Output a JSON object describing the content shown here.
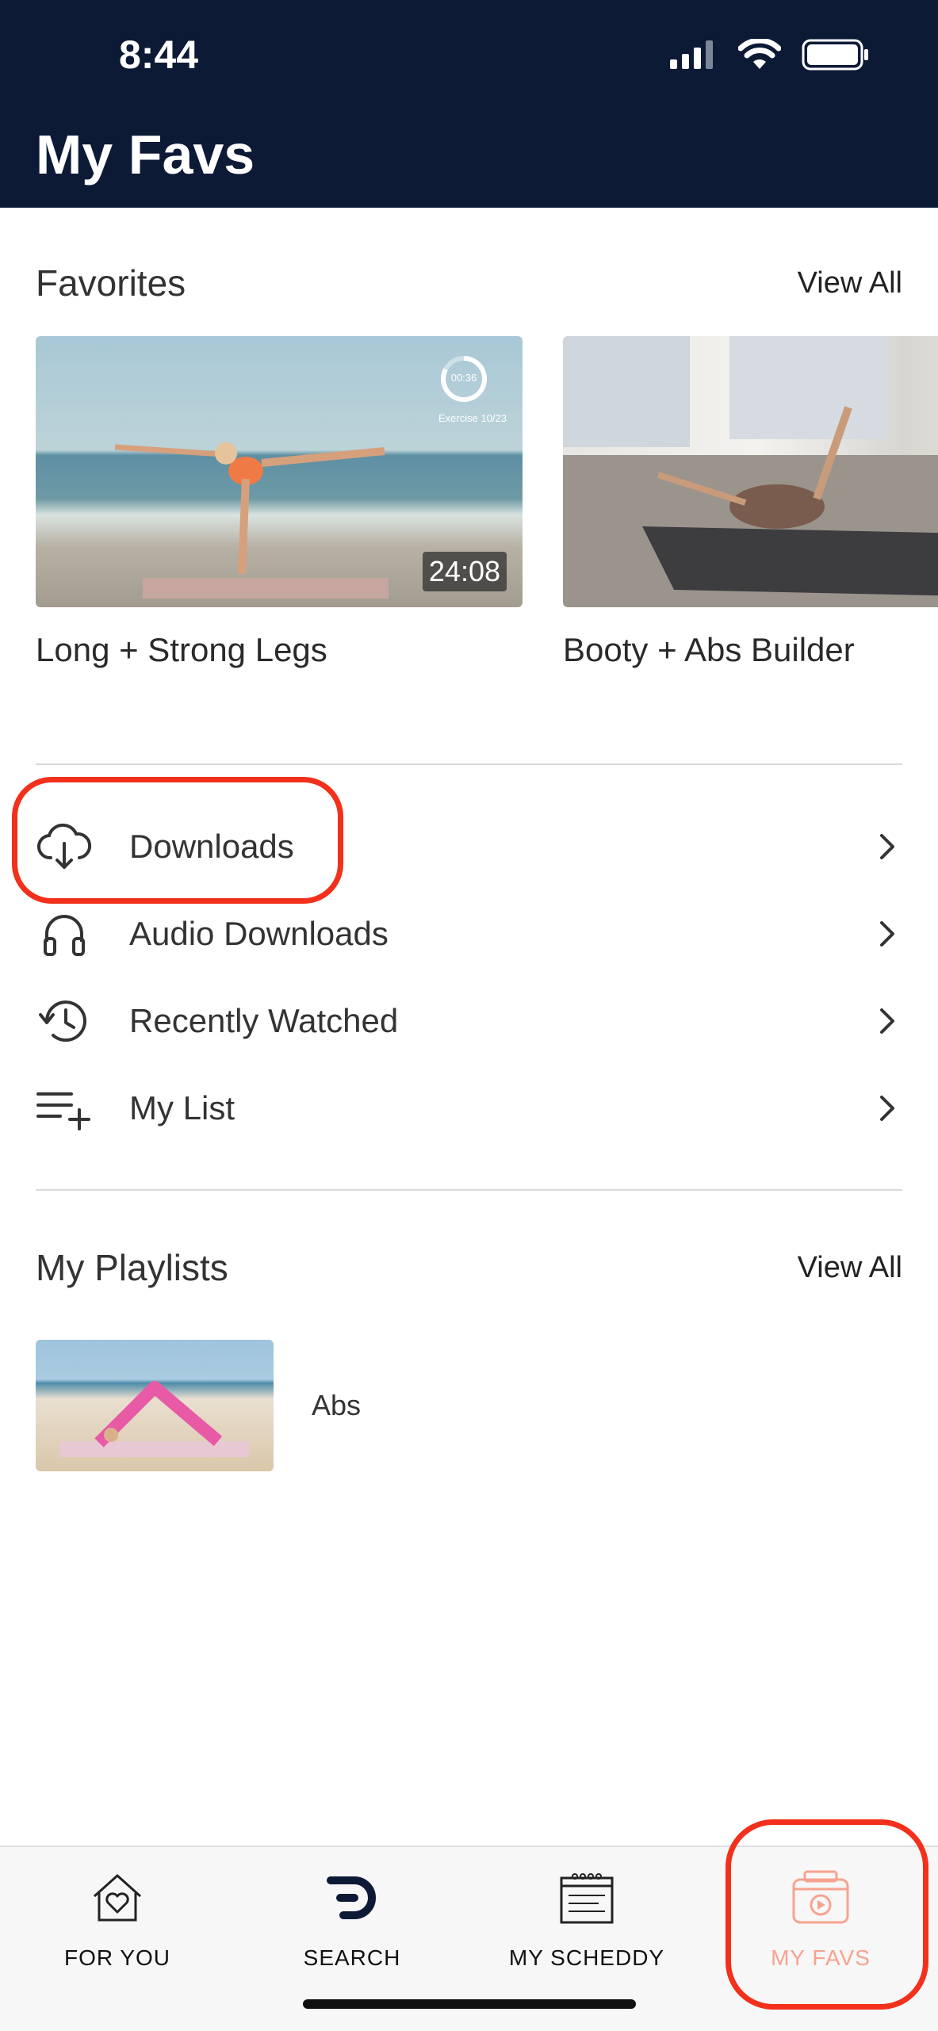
{
  "status_bar": {
    "time": "8:44"
  },
  "header": {
    "title": "My Favs"
  },
  "favorites": {
    "title": "Favorites",
    "view_all": "View All",
    "items": [
      {
        "title": "Long + Strong Legs",
        "duration": "24:08",
        "timer": "00:36",
        "exercise": "Exercise 10/23"
      },
      {
        "title": "Booty + Abs Builder"
      }
    ]
  },
  "menu": {
    "items": [
      {
        "label": "Downloads",
        "icon": "cloud-download-icon"
      },
      {
        "label": "Audio Downloads",
        "icon": "headphones-icon"
      },
      {
        "label": "Recently Watched",
        "icon": "history-icon"
      },
      {
        "label": "My List",
        "icon": "list-add-icon"
      }
    ]
  },
  "playlists": {
    "title": "My Playlists",
    "view_all": "View All",
    "items": [
      {
        "title": "Abs"
      }
    ]
  },
  "tabbar": {
    "tabs": [
      {
        "label": "FOR YOU",
        "icon": "home-heart-icon"
      },
      {
        "label": "SEARCH",
        "icon": "search-logo-icon"
      },
      {
        "label": "MY SCHEDDY",
        "icon": "calendar-icon"
      },
      {
        "label": "MY FAVS",
        "icon": "favs-bag-icon",
        "active": true
      }
    ]
  },
  "colors": {
    "header_bg": "#0d1a36",
    "active_tab": "#f7a38f",
    "highlight": "#f2301c"
  }
}
